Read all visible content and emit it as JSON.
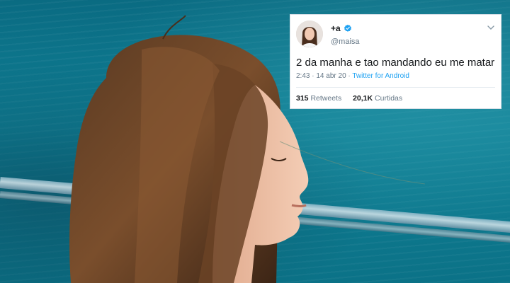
{
  "tweet": {
    "display_name": "+a",
    "handle": "@maisa",
    "text": "2 da manha e tao mandando eu me matar",
    "time": "2:43",
    "separator": "·",
    "date": "14 abr 20",
    "source": "Twitter for Android",
    "retweets_count": "315",
    "retweets_label": "Retweets",
    "likes_count": "20,1K",
    "likes_label": "Curtidas"
  },
  "colors": {
    "twitter_blue": "#1da1f2",
    "water": "#0b6f86",
    "secondary_text": "#657786"
  },
  "icons": {
    "verified": "verified-badge-icon",
    "menu": "chevron-down-icon"
  }
}
